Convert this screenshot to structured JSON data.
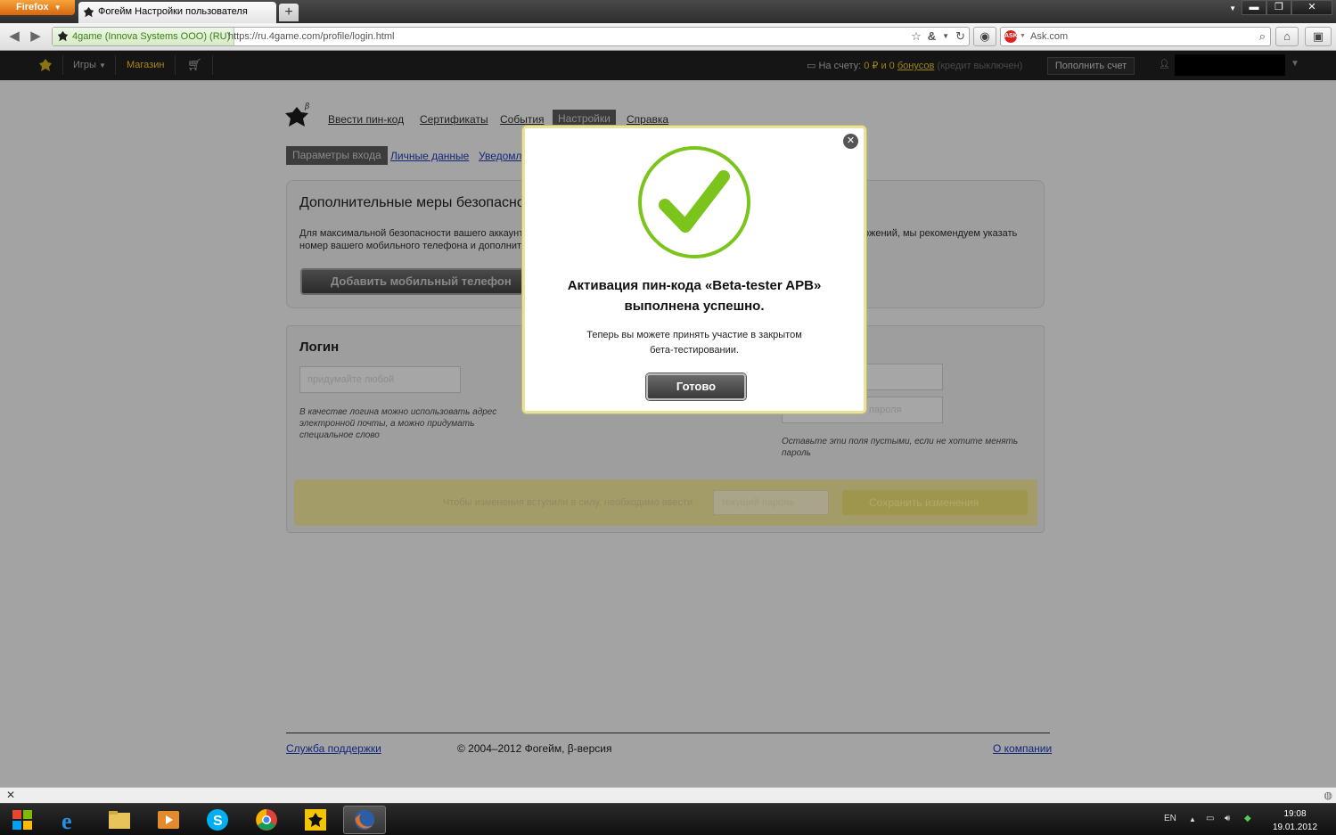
{
  "browser": {
    "app_button": "Firefox",
    "tab_title": "Фогейм Настройки пользователя",
    "identity": "4game (Innova Systems OOO) (RU)",
    "url": "https://ru.4game.com/profile/login.html",
    "search_engine": "Ask.com"
  },
  "topnav": {
    "games": "Игры",
    "shop": "Магазин",
    "balance_prefix": "На счету:",
    "balance_value": "0 ₽",
    "balance_and": "и 0",
    "bonus_link": "бонусов",
    "credit_status": "(кредит выключен)",
    "refill_button": "Пополнить счет"
  },
  "site_menu": {
    "items": [
      "Ввести пин-код",
      "Сертификаты",
      "События",
      "Настройки",
      "Справка"
    ],
    "active": "Настройки"
  },
  "sub_menu": {
    "active": "Параметры входа",
    "items": [
      "Личные данные",
      "Уведомления"
    ]
  },
  "security_panel": {
    "title": "Дополнительные меры безопасности",
    "text_line1": "Для максимальной безопасности вашего аккаунта",
    "text_line1_right": "ожений, мы рекомендуем указать",
    "text_line2": "номер вашего мобильного телефона и дополнительный",
    "button": "Добавить мобильный телефон"
  },
  "login_panel": {
    "title": "Логин",
    "placeholder": "придумайте любой",
    "hint": "В качестве логина можно использовать адрес электронной почты, а можно придумать специальное слово",
    "password_repeat_placeholder": "пароля",
    "password_hint": "Оставьте эти поля пустыми, если не хотите менять пароль"
  },
  "save_bar": {
    "text": "Чтобы изменения вступили в силу, необходимо ввести",
    "password_placeholder": "текущий пароль",
    "save_button": "Сохранить изменения"
  },
  "footer": {
    "support": "Служба поддержки",
    "copyright": "© 2004–2012 Фогейм, β-версия",
    "about": "О компании"
  },
  "modal": {
    "title_line1": "Активация пин-кода «Beta-tester APB»",
    "title_line2": "выполнена успешно.",
    "text_line1": "Теперь вы можете принять участие в закрытом",
    "text_line2": "бета-тестировании.",
    "ok_button": "Готово",
    "check_color": "#7bc41c"
  },
  "taskbar": {
    "lang": "EN",
    "time": "19:08",
    "date": "19.01.2012"
  }
}
